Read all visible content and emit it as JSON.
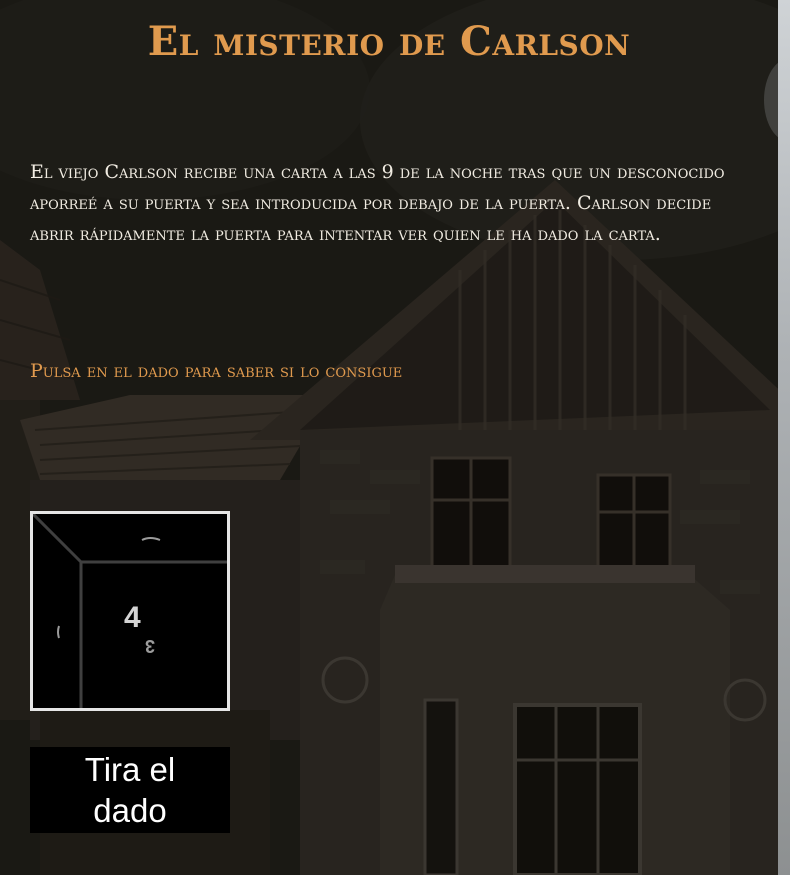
{
  "game": {
    "title": "El misterio de Carlson",
    "story": "El viejo Carlson recibe una carta a las 9 de la noche tras que un desconocido aporreé a su puerta y sea introducida por debajo de la puerta. Carlson decide abrir rápidamente la puerta para intentar ver quien le ha dado la carta.",
    "prompt": "Pulsa en el dado para saber si lo consigue",
    "die": {
      "value": "4"
    },
    "roll_button": "Tira el dado"
  }
}
